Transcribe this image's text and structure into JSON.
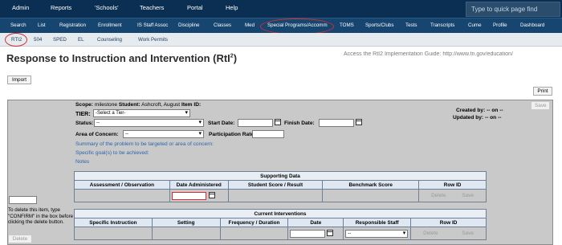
{
  "topnav": {
    "items": [
      "Admin",
      "Reports",
      "'Schools'",
      "Teachers",
      "Portal",
      "Help"
    ],
    "search_placeholder": "Type to quick page find"
  },
  "subnav": {
    "items": [
      "Search",
      "List",
      "Registration",
      "Enrollment",
      "IS Staff Assoc",
      "Discipline",
      "Classes",
      "Med",
      "Special Programs/Accomm",
      "TOMS",
      "Sports/Clubs",
      "Tests",
      "Transcripts",
      "Cume",
      "Profile",
      "Dashboard"
    ],
    "active": "Special Programs/Accomm"
  },
  "thirdnav": {
    "items": [
      "RTI2",
      "504",
      "SPED",
      "EL",
      "Counseling",
      "Work Permits"
    ],
    "active": "RTI2"
  },
  "page": {
    "title_main": "Response to Instruction and Intervention (RtI",
    "title_sup": "2",
    "title_close": ")",
    "help_link": "Access the RtI2 Implementation Guide: http://www.tn.gov/education/",
    "import_label": "Import",
    "print_label": "Print"
  },
  "form": {
    "scope_label": "Scope:",
    "scope_value": "milestone",
    "student_label": "Student:",
    "student_value": "Ashcroft, August",
    "item_id_label": "Item ID:",
    "tier_label": "TIER:",
    "tier_value": "-Select a Tier-",
    "status_label": "Status:",
    "status_value": "--",
    "start_date_label": "Start Date:",
    "finish_date_label": "Finish Date:",
    "area_label": "Area of Concern:",
    "area_value": "--",
    "participation_label": "Participation Rate:",
    "created_by": "Created by: -- on --",
    "updated_by": "Updated by: -- on --",
    "save_label": "Save",
    "links": [
      "Summary of the problem to be targeted or area of concern:",
      "Specific goal(s) to be achieved:",
      "Notes"
    ]
  },
  "supporting_data": {
    "caption": "Supporting Data",
    "columns": [
      "Assessment / Observation",
      "Date Administered",
      "Student Score / Result",
      "Benchmark Score",
      "Row ID"
    ],
    "delete_label": "Delete",
    "save_label": "Save"
  },
  "current_interventions": {
    "caption": "Current Interventions",
    "columns": [
      "Specific Instruction",
      "Setting",
      "Frequency / Duration",
      "Date",
      "Responsible Staff",
      "Row ID"
    ],
    "staff_value": "--",
    "delete_label": "Delete",
    "save_label": "Save"
  },
  "delete_section": {
    "instruction": "To delete this item, type \"CONFIRM\" in the box before clicking the delete button.",
    "delete_label": "Delete"
  }
}
